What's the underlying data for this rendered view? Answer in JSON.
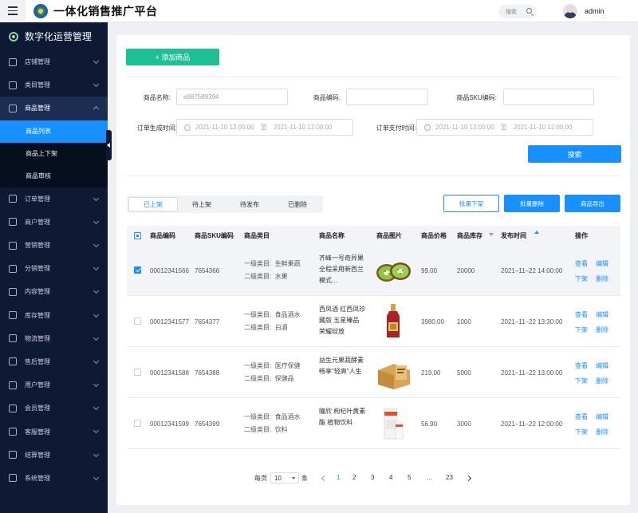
{
  "header": {
    "title": "一体化销售推广平台",
    "search_label": "搜索",
    "username": "admin"
  },
  "sidebar": {
    "brand": "数字化运营管理",
    "items": [
      {
        "label": "店铺管理",
        "icon": "store-icon"
      },
      {
        "label": "类目管理",
        "icon": "cube-icon"
      },
      {
        "label": "商品管理",
        "icon": "bag-icon",
        "active": true
      },
      {
        "label": "订单管理",
        "icon": "clipboard-icon"
      },
      {
        "label": "商户管理",
        "icon": "merchant-icon"
      },
      {
        "label": "营销管理",
        "icon": "chart-icon"
      },
      {
        "label": "分销管理",
        "icon": "network-icon"
      },
      {
        "label": "内容管理",
        "icon": "document-icon"
      },
      {
        "label": "库存管理",
        "icon": "warehouse-icon"
      },
      {
        "label": "物流管理",
        "icon": "truck-icon"
      },
      {
        "label": "售后管理",
        "icon": "service-icon"
      },
      {
        "label": "用户管理",
        "icon": "users-icon"
      },
      {
        "label": "会员管理",
        "icon": "diamond-icon"
      },
      {
        "label": "客服管理",
        "icon": "headset-icon"
      },
      {
        "label": "结算管理",
        "icon": "settlement-icon"
      },
      {
        "label": "系统管理",
        "icon": "gear-icon"
      }
    ],
    "sub_items": [
      "商品列表",
      "商品上下架",
      "商品审核"
    ]
  },
  "toolbar": {
    "add_label": "+ 添加商品"
  },
  "filters": {
    "name_label": "商品名称:",
    "name_value": "e987589394",
    "code_label": "商品编码:",
    "code_value": "",
    "sku_label": "商品SKU编码:",
    "sku_value": "",
    "created_label": "订单生成时间:",
    "paid_label": "订单支付时间:",
    "range_start": "2021-11-10 12:00:00",
    "range_sep": "至",
    "range_end": "2021-11-10 12:00:00",
    "search_label": "搜索"
  },
  "tabs": [
    "已上架",
    "待上架",
    "待发布",
    "已删除"
  ],
  "bulk": {
    "offshelf": "批量下架",
    "delete": "批量删除",
    "export": "商品导出"
  },
  "table": {
    "columns": [
      "商品编码",
      "商品SKU编码",
      "商品类目",
      "商品名称",
      "商品图片",
      "商品价格",
      "商品库存",
      "发布时间",
      "操作"
    ],
    "cat1_prefix": "一级类目:",
    "cat2_prefix": "二级类目:",
    "actions": {
      "view": "查看",
      "edit": "编辑",
      "offshelf": "下架",
      "delete": "删除"
    },
    "rows": [
      {
        "code": "00012341566",
        "sku": "7654366",
        "cat1": "生鲜果蔬",
        "cat2": "水果",
        "name": "齐峰一号奇异果 全程采用新西兰模式...",
        "image": "kiwi",
        "price": "99.00",
        "stock": "20000",
        "time": "2021–11–22  14:00:00",
        "checked": true
      },
      {
        "code": "00012341577",
        "sku": "7654377",
        "cat1": "食品酒水",
        "cat2": "白酒",
        "name": "西凤酒 红西凤珍藏版 五星臻品 荣耀绽放",
        "image": "liquor",
        "price": "3980.00",
        "stock": "1000",
        "time": "2021–11–22 13:30:00",
        "checked": false
      },
      {
        "code": "00012341588",
        "sku": "7654388",
        "cat1": "医疗保健",
        "cat2": "保健品",
        "name": "益生元果蔬酵素  畅享\"轻爽\"人生",
        "image": "enzyme-box",
        "price": "219.00",
        "stock": "5000",
        "time": "2021–11–22 13:00:00",
        "checked": false
      },
      {
        "code": "00012341599",
        "sku": "7654399",
        "cat1": "食品酒水",
        "cat2": "饮料",
        "name": "瞳欣 枸杞叶黄素酯 植物饮料",
        "image": "drink-box",
        "price": "56.90",
        "stock": "3000",
        "time": "2021–11–22 12:00:00",
        "checked": false
      }
    ]
  },
  "pagination": {
    "per_page_label": "每页",
    "per_page_value": "10",
    "unit_label": "条",
    "pages": [
      "1",
      "2",
      "3",
      "4",
      "5",
      "...",
      "23"
    ],
    "current": "1"
  },
  "colors": {
    "sidebar_bg": "#0e1a34",
    "primary": "#1890ff",
    "add_button": "#1fbf94"
  }
}
